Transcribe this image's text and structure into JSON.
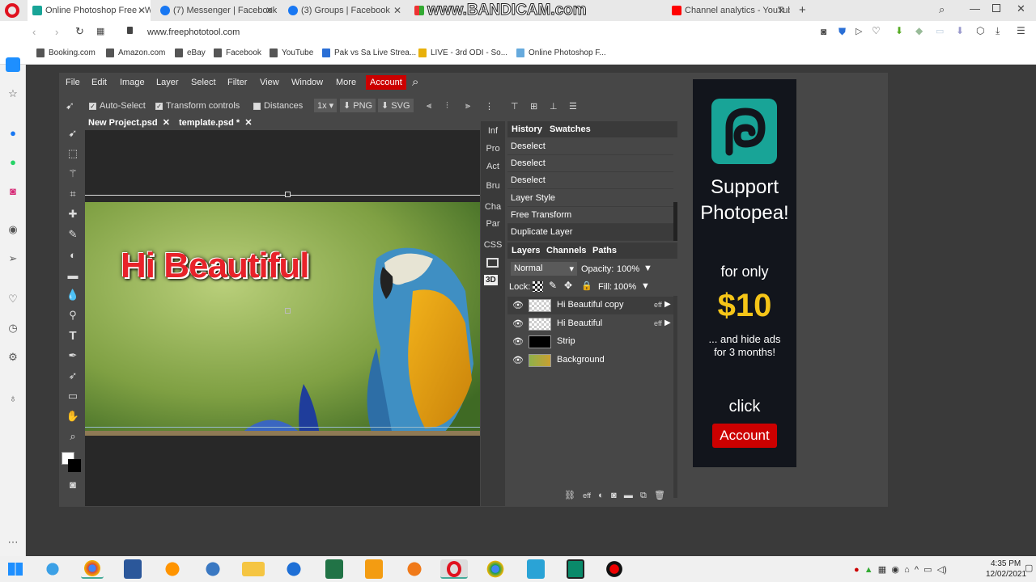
{
  "browser": {
    "tabs": [
      {
        "label": "Online Photoshop Free - W",
        "active": true
      },
      {
        "label": "(7) Messenger | Facebook"
      },
      {
        "label": "(3) Groups | Facebook"
      },
      {
        "label": "(3) www.BANDICAM.com"
      },
      {
        "label": "Channel analytics - YouTub"
      }
    ],
    "url": "www.freephototool.com",
    "bookmarks": [
      "Booking.com",
      "Amazon.com",
      "eBay",
      "Facebook",
      "YouTube",
      "Pak vs Sa Live Strea...",
      "LIVE - 3rd ODI - So...",
      "Online Photoshop F..."
    ]
  },
  "photopea": {
    "menu": [
      "File",
      "Edit",
      "Image",
      "Layer",
      "Select",
      "Filter",
      "View",
      "Window",
      "More"
    ],
    "account_label": "Account",
    "options": {
      "auto_select": "Auto-Select",
      "transform_controls": "Transform controls",
      "distances": "Distances",
      "zoom": "1x",
      "png": "PNG",
      "svg": "SVG"
    },
    "doc_tabs": [
      "New Project.psd",
      "template.psd *"
    ],
    "side_tabs": [
      "Inf",
      "Pro",
      "Act",
      "Bru",
      "Cha",
      "Par",
      "CSS"
    ],
    "history_tabs": [
      "History",
      "Swatches"
    ],
    "history": [
      "Deselect",
      "Deselect",
      "Deselect",
      "Layer Style",
      "Free Transform",
      "Duplicate Layer"
    ],
    "layer_tabs": [
      "Layers",
      "Channels",
      "Paths"
    ],
    "blend_mode": "Normal",
    "opacity_label": "Opacity:",
    "opacity": "100%",
    "lock_label": "Lock:",
    "fill_label": "Fill:",
    "fill": "100%",
    "layers": [
      {
        "name": "Hi Beautiful copy",
        "eff": "eff"
      },
      {
        "name": "Hi Beautiful",
        "eff": "eff"
      },
      {
        "name": "Strip",
        "eff": ""
      },
      {
        "name": "Background",
        "eff": ""
      }
    ],
    "canvas_text": "Hi Beautiful",
    "layer_footer_eff": "eff"
  },
  "ad": {
    "line1": "Support",
    "line2": "Photopea!",
    "for_only": "for only",
    "price": "$10",
    "hide1": "... and hide ads",
    "hide2": "for 3 months!",
    "click": "click",
    "button": "Account"
  },
  "taskbar": {
    "time": "4:35 PM",
    "date": "12/02/2021"
  },
  "watermark": "www.BANDICAM.com"
}
